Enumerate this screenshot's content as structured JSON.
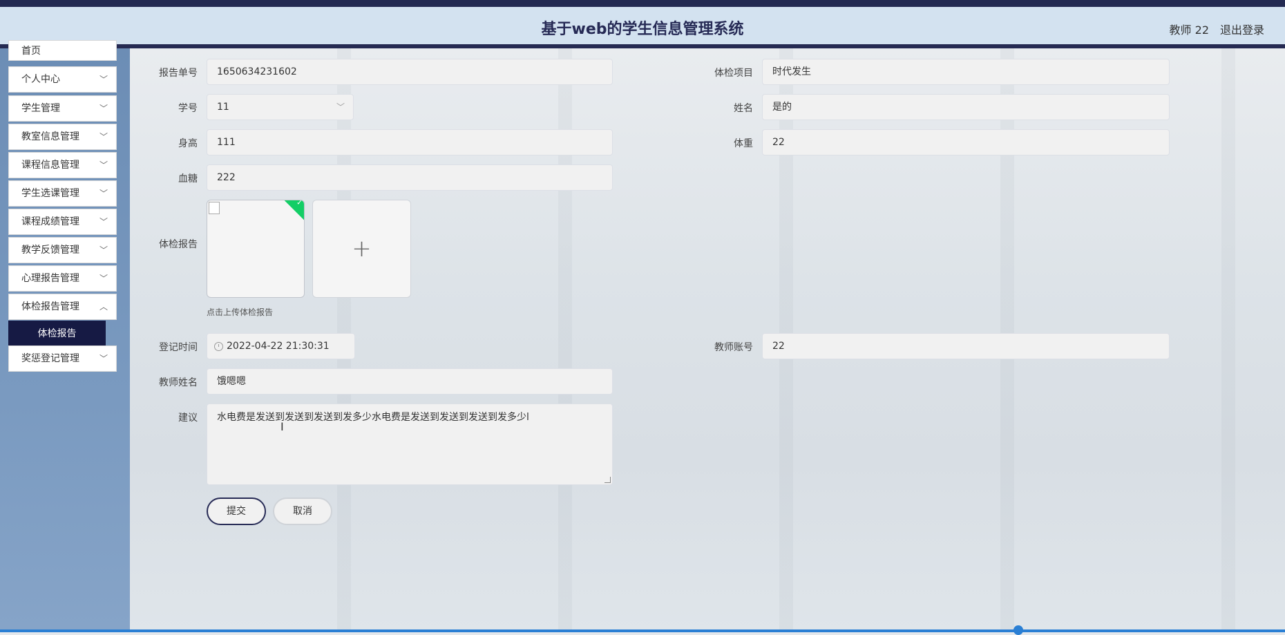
{
  "header": {
    "title": "基于web的学生信息管理系统",
    "user": "教师 22",
    "logout": "退出登录"
  },
  "sidebar": {
    "items": [
      {
        "label": "首页"
      },
      {
        "label": "个人中心"
      },
      {
        "label": "学生管理"
      },
      {
        "label": "教室信息管理"
      },
      {
        "label": "课程信息管理"
      },
      {
        "label": "学生选课管理"
      },
      {
        "label": "课程成绩管理"
      },
      {
        "label": "教学反馈管理"
      },
      {
        "label": "心理报告管理"
      },
      {
        "label": "体检报告管理"
      },
      {
        "label": "奖惩登记管理"
      }
    ],
    "sub_item": "体检报告",
    "chevron": "chevron-down-icon"
  },
  "form": {
    "report_no": {
      "label": "报告单号",
      "value": "1650634231602"
    },
    "exam_item": {
      "label": "体检项目",
      "value": "时代发生"
    },
    "student_id": {
      "label": "学号",
      "value": "11"
    },
    "name": {
      "label": "姓名",
      "value": "是的"
    },
    "height": {
      "label": "身高",
      "value": "111"
    },
    "weight": {
      "label": "体重",
      "value": "22"
    },
    "blood_sugar": {
      "label": "血糖",
      "value": "222"
    },
    "report": {
      "label": "体检报告",
      "hint": "点击上传体检报告",
      "add_symbol": "+"
    },
    "reg_time": {
      "label": "登记时间",
      "value": "2022-04-22 21:30:31"
    },
    "teacher_account": {
      "label": "教师账号",
      "value": "22"
    },
    "teacher_name": {
      "label": "教师姓名",
      "value": "饿嗯嗯"
    },
    "advice": {
      "label": "建议",
      "value": "水电费是发送到发送到发送到发多少水电费是发送到发送到发送到发多少l"
    },
    "submit": "提交",
    "cancel": "取消"
  },
  "colors": {
    "header_bg": "#d3e2f0",
    "brand_dark": "#262a55",
    "sidebar_bg": "#7a9ac0",
    "success": "#13ce66"
  }
}
